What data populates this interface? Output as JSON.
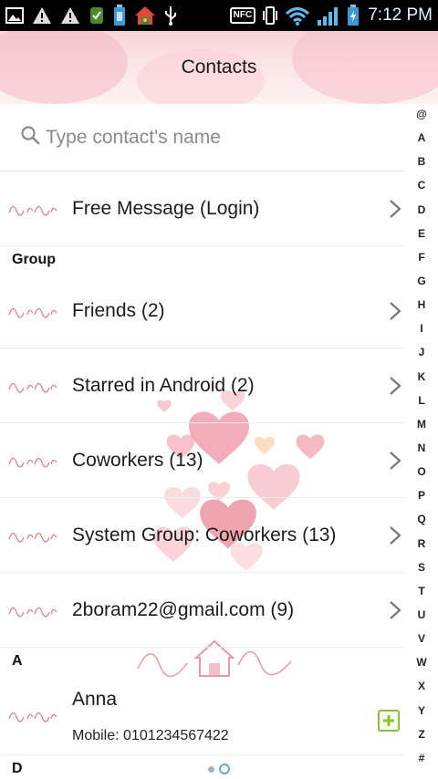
{
  "status_bar": {
    "time": "7:12 PM",
    "nfc_label": "NFC",
    "icons": [
      "gallery-icon",
      "warning-icon",
      "warning-icon",
      "app-notification-icon",
      "battery-saver-icon",
      "home-app-icon",
      "usb-icon",
      "nfc-icon",
      "vibrate-icon",
      "wifi-icon",
      "signal-icon",
      "battery-icon"
    ]
  },
  "header": {
    "title": "Contacts"
  },
  "search": {
    "placeholder": "Type contact's name"
  },
  "alphabet_index": [
    "@",
    "A",
    "B",
    "C",
    "D",
    "E",
    "F",
    "G",
    "H",
    "I",
    "J",
    "K",
    "L",
    "M",
    "N",
    "O",
    "P",
    "Q",
    "R",
    "S",
    "T",
    "U",
    "V",
    "W",
    "X",
    "Y",
    "Z",
    "#"
  ],
  "rows": {
    "free_message": {
      "label": "Free Message (Login)"
    },
    "group_header": "Group",
    "groups": [
      {
        "label": "Friends (2)"
      },
      {
        "label": "Starred in Android (2)"
      },
      {
        "label": "Coworkers (13)"
      },
      {
        "label": "System Group: Coworkers (13)"
      },
      {
        "label": "2boram22@gmail.com (9)"
      }
    ],
    "section_a": "A",
    "contact": {
      "name": "Anna",
      "phone": "Mobile:  0101234567422"
    },
    "section_d": "D"
  },
  "colors": {
    "accent_pink": "#d97a82",
    "add_green": "#8bbf3c",
    "pager_blue": "#6aa6d6"
  }
}
